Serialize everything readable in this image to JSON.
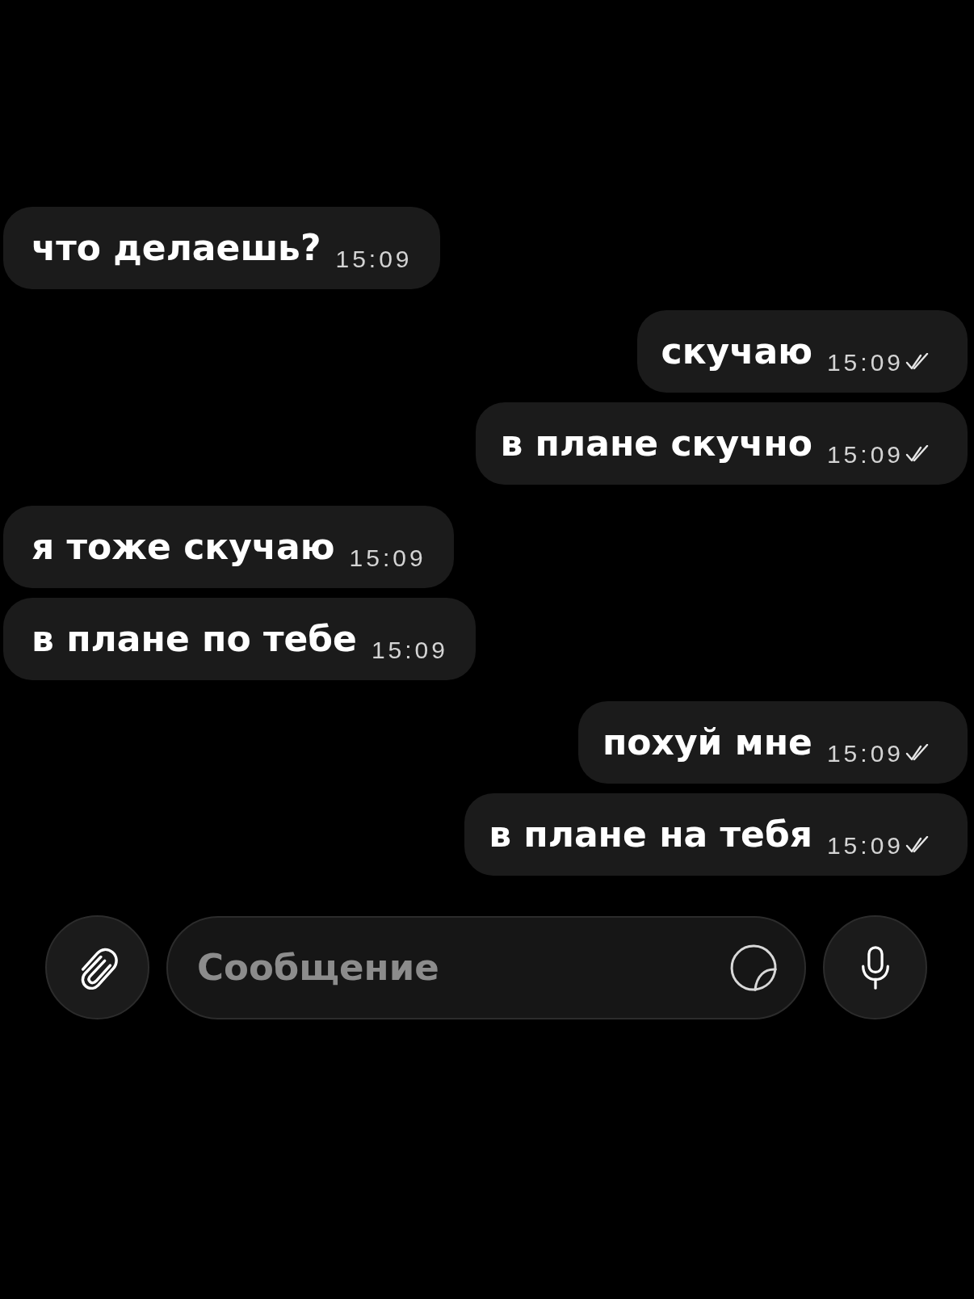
{
  "messages": [
    {
      "kind": "incoming",
      "text": "что делаешь?",
      "time": "15:09"
    },
    {
      "kind": "outgoing",
      "text": "скучаю",
      "time": "15:09",
      "read": true
    },
    {
      "kind": "outgoing",
      "text": "в плане скучно",
      "time": "15:09",
      "read": true
    },
    {
      "kind": "incoming",
      "text": "я тоже скучаю",
      "time": "15:09"
    },
    {
      "kind": "incoming",
      "text": "в плане по тебе",
      "time": "15:09"
    },
    {
      "kind": "outgoing",
      "text": "похуй мне",
      "time": "15:09",
      "read": true
    },
    {
      "kind": "outgoing",
      "text": "в плане на тебя",
      "time": "15:09",
      "read": true
    }
  ],
  "composer": {
    "placeholder": "Сообщение"
  }
}
